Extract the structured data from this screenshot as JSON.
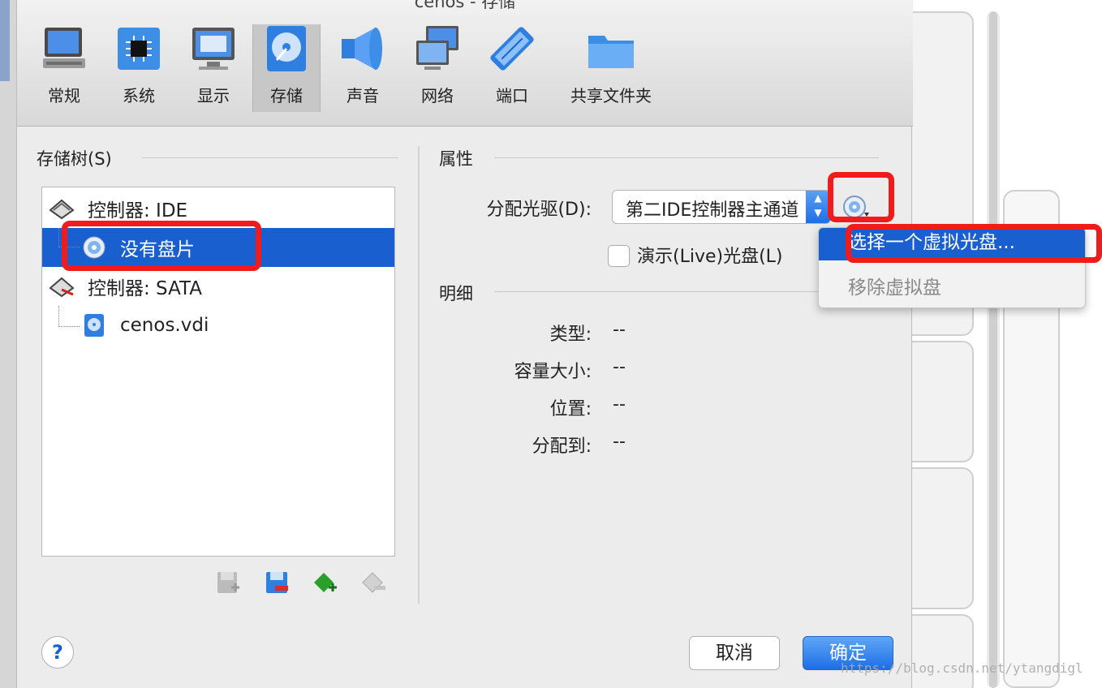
{
  "window": {
    "title": "cenos - 存储"
  },
  "toolbar": {
    "items": [
      {
        "label": "常规",
        "icon": "general-icon"
      },
      {
        "label": "系统",
        "icon": "system-chip-icon"
      },
      {
        "label": "显示",
        "icon": "display-monitor-icon"
      },
      {
        "label": "存储",
        "icon": "storage-disk-icon",
        "active": true
      },
      {
        "label": "声音",
        "icon": "audio-speaker-icon"
      },
      {
        "label": "网络",
        "icon": "network-icon"
      },
      {
        "label": "端口",
        "icon": "serial-port-icon"
      },
      {
        "label": "共享文件夹",
        "icon": "shared-folder-icon"
      }
    ]
  },
  "storage_tree": {
    "title": "存储树(S)",
    "items": [
      {
        "label": "控制器: IDE",
        "icon": "ide-controller-icon"
      },
      {
        "label": "没有盘片",
        "icon": "optical-disc-icon",
        "selected": true
      },
      {
        "label": "控制器: SATA",
        "icon": "sata-controller-icon"
      },
      {
        "label": "cenos.vdi",
        "icon": "hard-disk-icon"
      }
    ],
    "buttons": [
      "add-controller-icon",
      "remove-controller-icon",
      "add-attachment-icon",
      "remove-attachment-icon"
    ]
  },
  "attributes": {
    "title": "属性",
    "drive_label": "分配光驱(D):",
    "drive_value": "第二IDE控制器主通道",
    "live_cd_label": "演示(Live)光盘(L)",
    "live_cd_checked": false
  },
  "details": {
    "title": "明细",
    "rows": [
      {
        "label": "类型:",
        "value": "--"
      },
      {
        "label": "容量大小:",
        "value": "--"
      },
      {
        "label": "位置:",
        "value": "--"
      },
      {
        "label": "分配到:",
        "value": "--"
      }
    ]
  },
  "popup_menu": {
    "items": [
      {
        "label": "选择一个虚拟光盘...",
        "highlighted": true
      },
      {
        "label": "移除虚拟盘",
        "disabled": true
      }
    ]
  },
  "footer": {
    "help": "?",
    "cancel": "取消",
    "ok": "确定"
  },
  "watermark": "https://blog.csdn.net/ytangdigl",
  "colors": {
    "selection": "#1a5fd0",
    "annotation_red": "#f01b1b",
    "ok_button": "#1e6fe6"
  }
}
